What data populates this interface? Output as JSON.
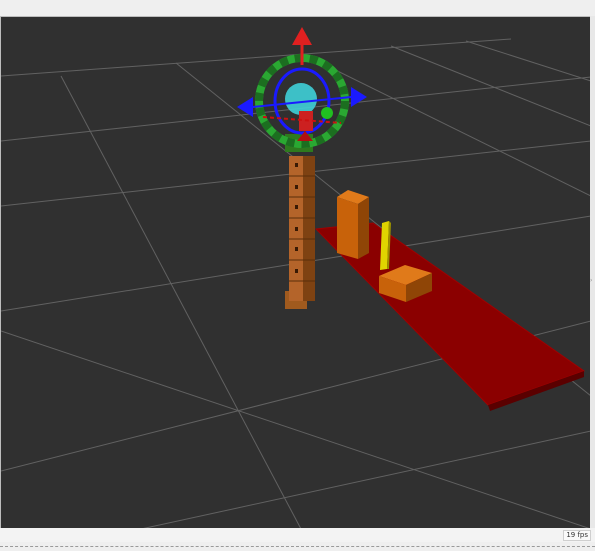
{
  "viewport": {
    "fps_label": "19 fps",
    "grid": true,
    "colors": {
      "background": "#303030",
      "grid": "#a0a0a0",
      "table": "#8b0000",
      "blocks": "#c8620a",
      "pole": "#e0d400",
      "ring_rotation": "#2aa832",
      "arrow_x": "#cc1010",
      "arrow_y": "#1a1aff",
      "arrow_z": "#e02020",
      "sphere": "#3fd0d8"
    }
  },
  "handle_glyph": "›"
}
